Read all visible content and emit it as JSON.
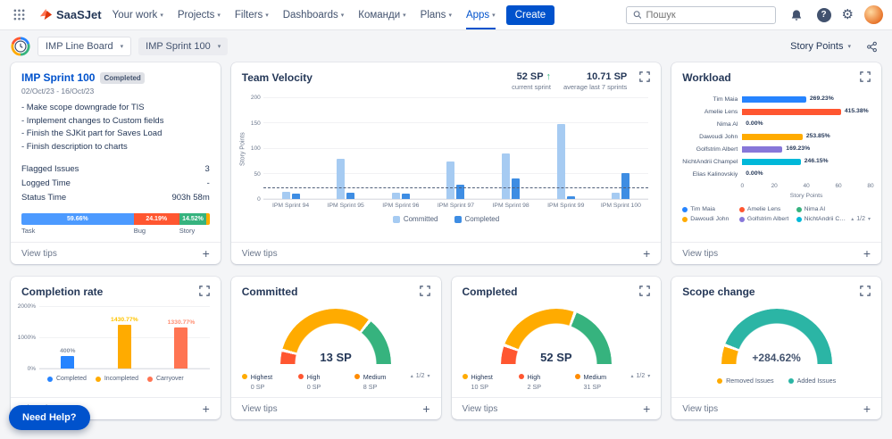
{
  "top_nav": {
    "logo_text": "SaaSJet",
    "items": [
      {
        "label": "Your work"
      },
      {
        "label": "Projects"
      },
      {
        "label": "Filters"
      },
      {
        "label": "Dashboards"
      },
      {
        "label": "Команди"
      },
      {
        "label": "Plans"
      },
      {
        "label": "Apps"
      }
    ],
    "create_label": "Create",
    "search_placeholder": "Пошук"
  },
  "toolbar": {
    "board_select": "IMP Line Board",
    "sprint_select": "IMP Sprint 100",
    "metric_select": "Story Points"
  },
  "help_button": "Need Help?",
  "colors": {
    "accent": "#0052CC",
    "task": "#4C9AFF",
    "bug": "#FF5630",
    "story": "#36B37E",
    "warning": "#FFAB00"
  },
  "cards": {
    "sprint": {
      "title": "IMP Sprint 100",
      "badge": "Completed",
      "dates": "02/Oct/23 - 16/Oct/23",
      "goals": [
        "- Make scope downgrade for TIS",
        "- Implement changes to Custom fields",
        "- Finish the SJKit part for Saves Load",
        "- Finish description to charts"
      ],
      "stats": [
        {
          "label": "Flagged Issues",
          "value": "3"
        },
        {
          "label": "Logged Time",
          "value": "-"
        },
        {
          "label": "Status Time",
          "value": "903h 58m"
        }
      ],
      "distribution": [
        {
          "label": "Task",
          "pct": 59.66,
          "text": "59.66%",
          "color": "#4C9AFF"
        },
        {
          "label": "Bug",
          "pct": 24.19,
          "text": "24.19%",
          "color": "#FF5630"
        },
        {
          "label": "Story",
          "pct": 14.52,
          "text": "14.52%",
          "color": "#36B37E"
        },
        {
          "label": "",
          "pct": 1.63,
          "text": "",
          "color": "#FFAB00"
        }
      ],
      "view_tips": "View tips"
    },
    "velocity": {
      "title": "Team Velocity",
      "current_value": "52 SP",
      "current_arrow": "↑",
      "current_caption": "current sprint",
      "average_value": "10.71 SP",
      "average_caption": "average last 7 sprints",
      "view_tips": "View tips",
      "chart_data": {
        "type": "bar",
        "categories": [
          "IPM Sprint 94",
          "IPM Sprint 95",
          "IPM Sprint 96",
          "IPM Sprint 97",
          "IPM Sprint 98",
          "IPM Sprint 99",
          "IPM Sprint 100"
        ],
        "series": [
          {
            "name": "Committed",
            "color": "#A6CBF2",
            "values": [
              15,
              80,
              13,
              75,
              90,
              148,
              13
            ]
          },
          {
            "name": "Completed",
            "color": "#3E8DE3",
            "values": [
              10,
              13,
              10,
              28,
              40,
              5,
              52
            ]
          }
        ],
        "ylabel": "Story Points",
        "yticks": [
          0,
          50,
          100,
          150,
          200
        ],
        "ylim": [
          0,
          200
        ],
        "average_line": 22,
        "legend_position": "bottom"
      }
    },
    "workload": {
      "title": "Workload",
      "pagination": "1/2",
      "view_tips": "View tips",
      "chart_data": {
        "type": "bar-horizontal",
        "xlabel": "Story Points",
        "xticks": [
          0,
          20,
          40,
          60,
          80
        ],
        "scale_max": 540,
        "rows": [
          {
            "name": "Tim Maia",
            "value": "269.23%",
            "pct": 269.23,
            "color": "#2684FF"
          },
          {
            "name": "Amelie Lens",
            "value": "415.38%",
            "pct": 415.38,
            "color": "#FF5630"
          },
          {
            "name": "Nima Al",
            "value": "0.00%",
            "pct": 0,
            "color": "#36B37E"
          },
          {
            "name": "Dawoudi John",
            "value": "253.85%",
            "pct": 253.85,
            "color": "#FFAB00"
          },
          {
            "name": "Golfstrim Albert",
            "value": "169.23%",
            "pct": 169.23,
            "color": "#8777D9"
          },
          {
            "name": "NichtAndrii Champel",
            "value": "246.15%",
            "pct": 246.15,
            "color": "#00B8D9"
          },
          {
            "name": "Elias Kalinovskiy",
            "value": "0.00%",
            "pct": 0,
            "color": "#6B778C"
          }
        ],
        "legend": [
          {
            "label": "Tim Maia",
            "color": "#2684FF"
          },
          {
            "label": "Amelie Lens",
            "color": "#FF5630"
          },
          {
            "label": "Nima Al",
            "color": "#36B37E"
          },
          {
            "label": "Dawoudi John",
            "color": "#FFAB00"
          },
          {
            "label": "Golfstrim Albert",
            "color": "#8777D9"
          },
          {
            "label": "NichtAndrii Champel",
            "color": "#00B8D9"
          }
        ]
      }
    },
    "completion": {
      "title": "Completion rate",
      "view_tips": "View tips",
      "chart_data": {
        "type": "bar",
        "yticks": [
          "0%",
          "1000%",
          "2000%"
        ],
        "ylim": [
          0,
          2000
        ],
        "bars": [
          {
            "label": "Completed",
            "value": 400,
            "value_label": "400%",
            "color": "#2684FF",
            "label_color": "#8993A4"
          },
          {
            "label": "Incompleted",
            "value": 1430.77,
            "value_label": "1430.77%",
            "color": "#FFAB00",
            "label_color": "#FFC400"
          },
          {
            "label": "Carryover",
            "value": 1330.77,
            "value_label": "1330.77%",
            "color": "#FF7452",
            "label_color": "#FF8F73"
          }
        ]
      }
    },
    "committed": {
      "title": "Committed",
      "pagination": "1/2",
      "view_tips": "View tips",
      "chart_data": {
        "type": "gauge",
        "value": "13 SP",
        "segments": [
          {
            "color": "#FF5630",
            "pct": 9
          },
          {
            "color": "#FFAB00",
            "pct": 63
          },
          {
            "color": "#36B37E",
            "pct": 28
          }
        ]
      },
      "legend": [
        {
          "label": "Highest",
          "value": "0 SP",
          "color": "#FFAB00"
        },
        {
          "label": "High",
          "value": "0 SP",
          "color": "#FF5630"
        },
        {
          "label": "Medium",
          "value": "8 SP",
          "color": "#FF8B00"
        }
      ]
    },
    "completed": {
      "title": "Completed",
      "pagination": "1/2",
      "view_tips": "View tips",
      "chart_data": {
        "type": "gauge",
        "value": "52 SP",
        "segments": [
          {
            "color": "#FF5630",
            "pct": 12
          },
          {
            "color": "#FFAB00",
            "pct": 50
          },
          {
            "color": "#36B37E",
            "pct": 38
          }
        ]
      },
      "legend": [
        {
          "label": "Highest",
          "value": "10 SP",
          "color": "#FFAB00"
        },
        {
          "label": "High",
          "value": "2 SP",
          "color": "#FF5630"
        },
        {
          "label": "Medium",
          "value": "31 SP",
          "color": "#FF8B00"
        }
      ]
    },
    "scope": {
      "title": "Scope change",
      "view_tips": "View tips",
      "chart_data": {
        "type": "gauge",
        "value": "+284.62%",
        "segments": [
          {
            "color": "#FFAB00",
            "pct": 12
          },
          {
            "color": "#2BB5A5",
            "pct": 88
          }
        ]
      },
      "legend": [
        {
          "label": "Removed Issues",
          "color": "#FFAB00"
        },
        {
          "label": "Added Issues",
          "color": "#2BB5A5"
        }
      ]
    }
  }
}
